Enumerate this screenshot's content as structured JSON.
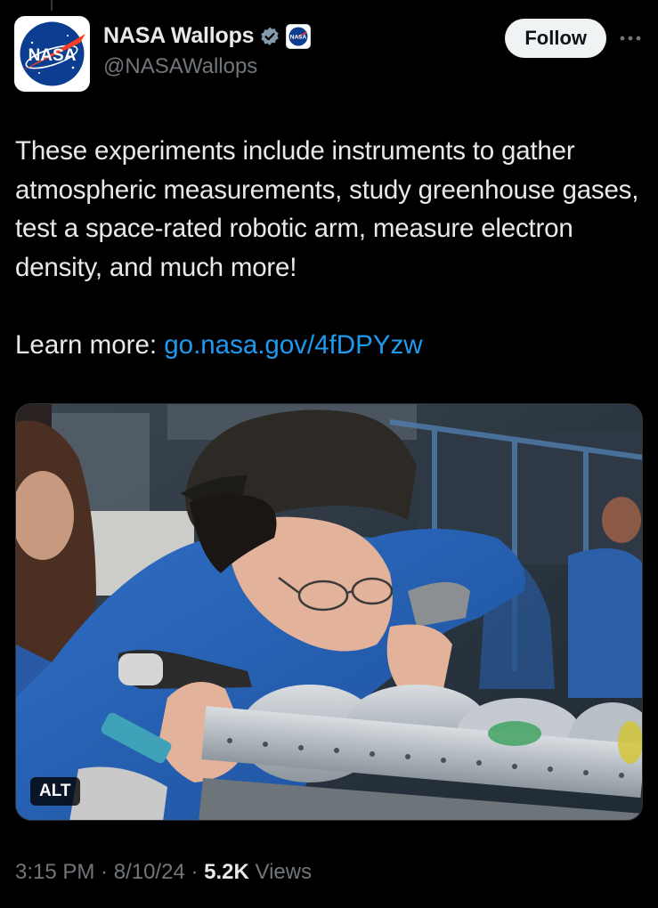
{
  "account": {
    "display_name": "NASA Wallops",
    "handle": "@NASAWallops",
    "avatar_label": "NASA",
    "verified_icon": "verified-badge-icon",
    "affiliate_icon": "nasa-affiliate-icon"
  },
  "follow_label": "Follow",
  "more_icon": "more-options-icon",
  "tweet": {
    "text": "These experiments include instruments to gather atmospheric measurements, study greenhouse gases, test a space-rated robotic arm, measure electron density, and much more!",
    "learn_more_label": "Learn more: ",
    "link_text": "go.nasa.gov/4fDPYzw"
  },
  "media": {
    "alt_label": "ALT"
  },
  "meta": {
    "time": "3:15 PM",
    "sep1": " · ",
    "date": "8/10/24",
    "sep2": " · ",
    "views_count": "5.2K",
    "views_label": " Views"
  },
  "colors": {
    "background": "#000000",
    "text": "#e7e9ea",
    "muted": "#71767b",
    "link": "#1d9bf0",
    "verified": "#829aab"
  }
}
